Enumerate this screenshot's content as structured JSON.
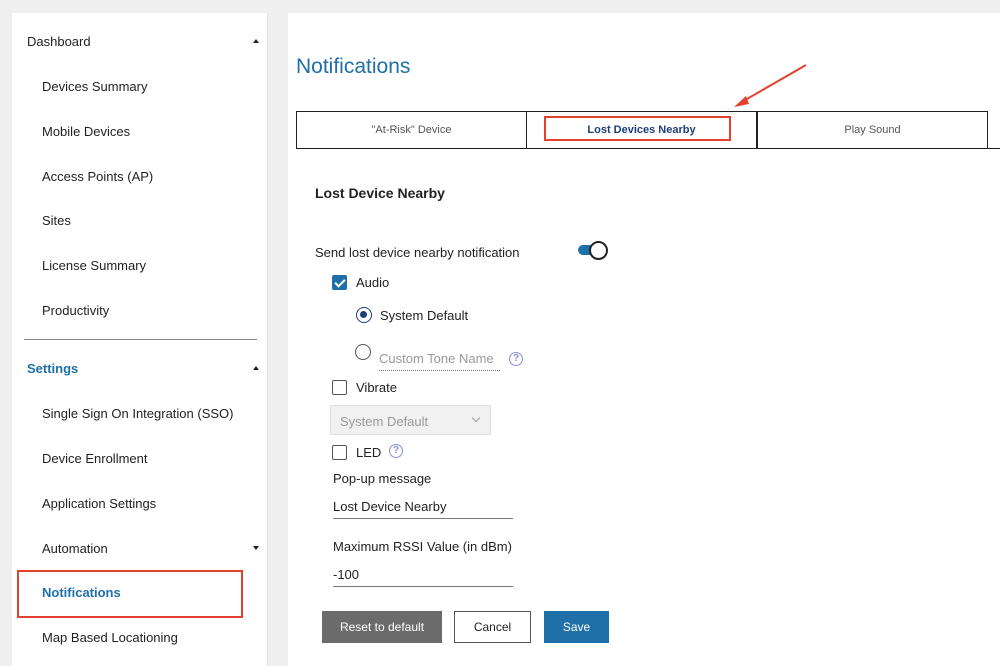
{
  "sidebar": {
    "dashboard": {
      "label": "Dashboard"
    },
    "dashboard_items": [
      {
        "label": "Devices Summary"
      },
      {
        "label": "Mobile Devices"
      },
      {
        "label": "Access Points (AP)"
      },
      {
        "label": "Sites"
      },
      {
        "label": "License Summary"
      },
      {
        "label": "Productivity"
      }
    ],
    "settings": {
      "label": "Settings"
    },
    "settings_items": [
      {
        "label": "Single Sign On Integration (SSO)"
      },
      {
        "label": "Device Enrollment"
      },
      {
        "label": "Application Settings"
      },
      {
        "label": "Automation"
      },
      {
        "label": "Notifications"
      },
      {
        "label": "Map Based Locationing"
      }
    ]
  },
  "main": {
    "title": "Notifications",
    "tabs": [
      {
        "label": "\"At-Risk\" Device"
      },
      {
        "label": "Lost Devices Nearby"
      },
      {
        "label": "Play Sound"
      }
    ],
    "section_title": "Lost Device Nearby",
    "send_notification_label": "Send lost device nearby notification",
    "send_notification_enabled": true,
    "audio": {
      "label": "Audio",
      "checked": true
    },
    "system_default_radio": {
      "label": "System Default",
      "selected": true
    },
    "custom_tone": {
      "placeholder": "Custom Tone Name",
      "selected": false
    },
    "vibrate": {
      "label": "Vibrate",
      "checked": false
    },
    "vibrate_select": {
      "value": "System Default"
    },
    "led": {
      "label": "LED",
      "checked": false
    },
    "popup": {
      "label": "Pop-up message",
      "value": "Lost Device Nearby"
    },
    "rssi": {
      "label": "Maximum RSSI Value (in dBm)",
      "value": "-100"
    },
    "buttons": {
      "reset": "Reset to default",
      "cancel": "Cancel",
      "save": "Save"
    }
  },
  "colors": {
    "accent": "#1f6fa9",
    "annotation": "#e2412f",
    "reset_button": "#6b6b6b"
  }
}
